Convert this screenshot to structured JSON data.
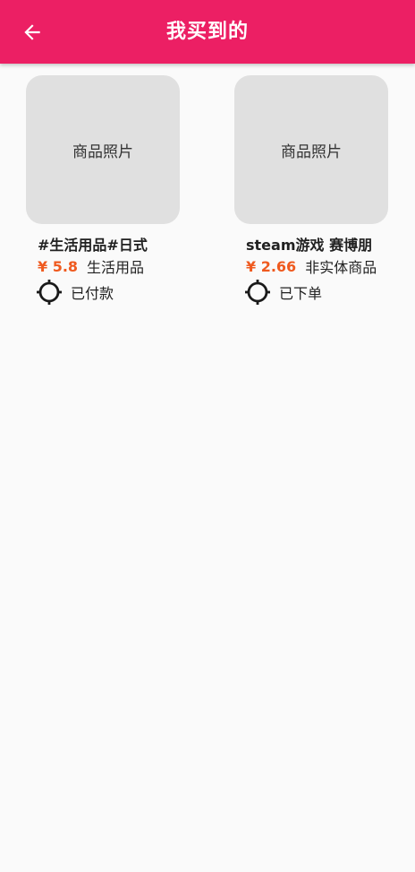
{
  "app": {
    "title": "我买到的",
    "colors": {
      "primary": "#ec1f64",
      "price": "#ef5a1f",
      "placeholder_bg": "#e0e0e0",
      "background": "#fafafa"
    }
  },
  "header": {
    "back_icon": "arrow-left-icon",
    "title": "我买到的"
  },
  "items": [
    {
      "photo_label": "商品照片",
      "name": "#生活用品#日式",
      "price": "¥ 5.8",
      "category": "生活用品",
      "status_icon": "crosshair-icon",
      "status": "已付款"
    },
    {
      "photo_label": "商品照片",
      "name": "steam游戏 赛博朋",
      "price": "¥ 2.66",
      "category": "非实体商品",
      "status_icon": "crosshair-icon",
      "status": "已下单"
    }
  ]
}
